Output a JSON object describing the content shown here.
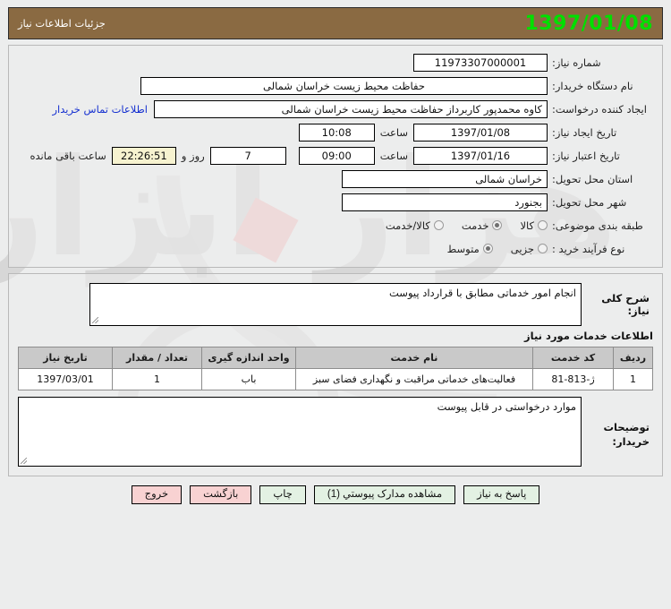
{
  "header": {
    "title": "جزئیات اطلاعات نیاز",
    "date": "1397/01/08",
    "bar_color": "#8a6a42",
    "date_color": "#00e000"
  },
  "form": {
    "need_number": {
      "label": "شماره نیاز:",
      "value": "11973307000001"
    },
    "buyer_org": {
      "label": "نام دستگاه خریدار:",
      "value": "حفاظت محیط زیست خراسان شمالی"
    },
    "creator": {
      "label": "ایجاد کننده درخواست:",
      "value": "کاوه  محمدپور  کاربرداز حفاظت محیط زیست خراسان شمالی",
      "contact_link": "اطلاعات تماس خریدار"
    },
    "create_date": {
      "label": "تاریخ ایجاد نیاز:",
      "value": "1397/01/08",
      "time_label": "ساعت",
      "time_value": "10:08"
    },
    "valid_date": {
      "label": "تاریخ اعتبار نیاز:",
      "value": "1397/01/16",
      "time_label": "ساعت",
      "time_value": "09:00",
      "days_value": "7",
      "days_label": "روز و",
      "countdown": "22:26:51",
      "countdown_label": "ساعت باقی مانده",
      "countdown_bg": "#f7f3d0"
    },
    "province": {
      "label": "استان محل تحویل:",
      "value": "خراسان شمالی"
    },
    "city": {
      "label": "شهر محل تحویل:",
      "value": "بجنورد"
    },
    "category": {
      "label": "طبقه بندی موضوعی:",
      "options": [
        {
          "label": "کالا",
          "selected": false
        },
        {
          "label": "خدمت",
          "selected": true
        },
        {
          "label": "کالا/خدمت",
          "selected": false
        }
      ]
    },
    "process_type": {
      "label": "نوع فرآیند خرید :",
      "options": [
        {
          "label": "جزیی",
          "selected": false
        },
        {
          "label": "متوسط",
          "selected": true
        }
      ]
    }
  },
  "description": {
    "label": "شرح کلی نیاز:",
    "value": "انجام امور خدماتی مطابق با قرارداد پیوست"
  },
  "services": {
    "section_title": "اطلاعات خدمات مورد نیاز",
    "columns": [
      "ردیف",
      "کد خدمت",
      "نام خدمت",
      "واحد اندازه گیری",
      "تعداد / مقدار",
      "تاریخ نیاز"
    ],
    "rows": [
      {
        "index": "1",
        "code": "ژ-813-81",
        "name": "فعالیت‌های خدماتی مراقبت و نگهداری فضای سبز",
        "unit": "باب",
        "quantity": "1",
        "date": "1397/03/01"
      }
    ]
  },
  "buyer_notes": {
    "label_line1": "توضیحات",
    "label_line2": "خریدار:",
    "value": "موارد درخواستی در قابل پیوست"
  },
  "buttons": [
    {
      "name": "respond",
      "label": "پاسخ به نیاز",
      "style": "normal"
    },
    {
      "name": "view-attachments",
      "label": "مشاهده مدارک پیوستي (1)",
      "style": "normal"
    },
    {
      "name": "print",
      "label": "چاپ",
      "style": "normal"
    },
    {
      "name": "back",
      "label": "بازگشت",
      "style": "danger"
    },
    {
      "name": "exit",
      "label": "خروج",
      "style": "danger"
    }
  ]
}
